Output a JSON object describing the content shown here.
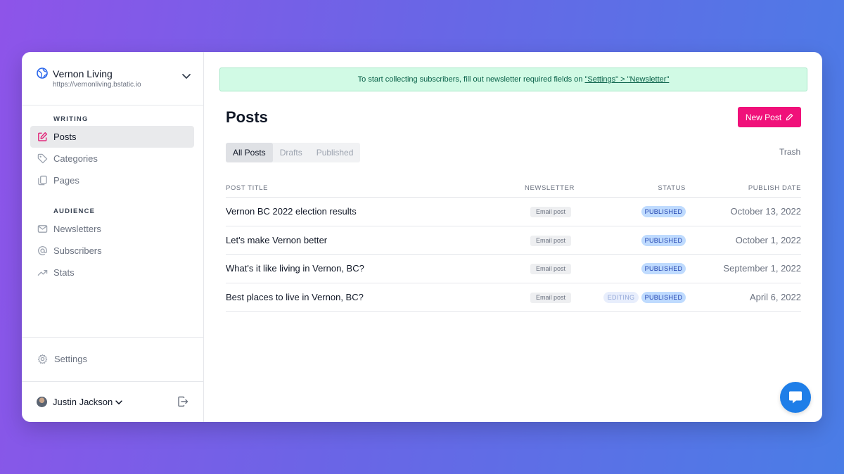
{
  "site": {
    "name": "Vernon Living",
    "url": "https://vernonliving.bstatic.io"
  },
  "sidebar": {
    "sections": [
      {
        "label": "WRITING",
        "items": [
          {
            "label": "Posts",
            "icon": "edit-icon",
            "active": true
          },
          {
            "label": "Categories",
            "icon": "tag-icon",
            "active": false
          },
          {
            "label": "Pages",
            "icon": "pages-icon",
            "active": false
          }
        ]
      },
      {
        "label": "AUDIENCE",
        "items": [
          {
            "label": "Newsletters",
            "icon": "mail-icon",
            "active": false
          },
          {
            "label": "Subscribers",
            "icon": "at-icon",
            "active": false
          },
          {
            "label": "Stats",
            "icon": "trending-up-icon",
            "active": false
          }
        ]
      }
    ],
    "settings_label": "Settings",
    "user_name": "Justin Jackson"
  },
  "banner": {
    "text": "To start collecting subscribers, fill out newsletter required fields on ",
    "link_settings": "\"Settings\"",
    "separator": " > ",
    "link_newsletter": "\"Newsletter\""
  },
  "page": {
    "title": "Posts",
    "new_post_label": "New Post",
    "trash_label": "Trash",
    "tabs": [
      "All Posts",
      "Drafts",
      "Published"
    ],
    "active_tab": "All Posts"
  },
  "table": {
    "headers": {
      "title": "POST TITLE",
      "newsletter": "NEWSLETTER",
      "status": "STATUS",
      "date": "PUBLISH DATE"
    },
    "rows": [
      {
        "title": "Vernon BC 2022 election results",
        "newsletter": "Email post",
        "editing": "",
        "status": "PUBLISHED",
        "date": "October 13, 2022"
      },
      {
        "title": "Let's make Vernon better",
        "newsletter": "Email post",
        "editing": "",
        "status": "PUBLISHED",
        "date": "October 1, 2022"
      },
      {
        "title": "What's it like living in Vernon, BC?",
        "newsletter": "Email post",
        "editing": "",
        "status": "PUBLISHED",
        "date": "September 1, 2022"
      },
      {
        "title": "Best places to live in Vernon, BC?",
        "newsletter": "Email post",
        "editing": "EDITING",
        "status": "PUBLISHED",
        "date": "April 6, 2022"
      }
    ]
  },
  "colors": {
    "accent": "#f0117a",
    "banner_bg": "#d1fae5",
    "status_bg": "#bfdbfe",
    "chat": "#1e7ee8"
  }
}
